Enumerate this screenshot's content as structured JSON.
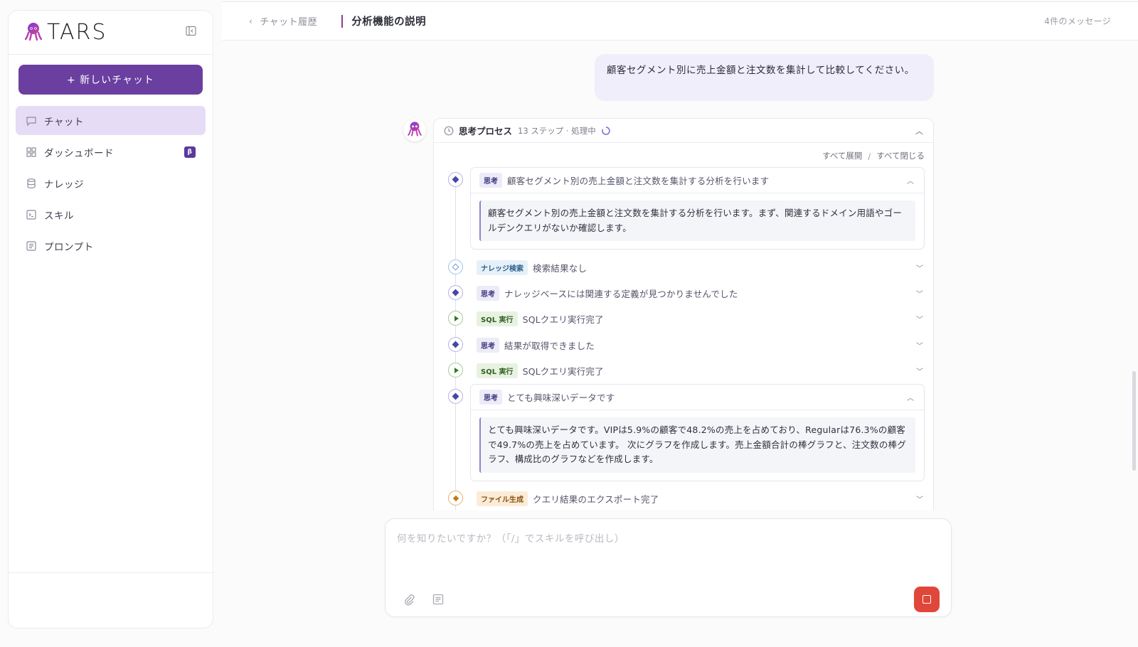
{
  "sidebar": {
    "logo_text": "TARS",
    "new_chat_label": "+ 新しいチャット",
    "items": [
      {
        "label": "チャット",
        "icon": "chat-icon",
        "active": true
      },
      {
        "label": "ダッシュボード",
        "icon": "dashboard-icon",
        "badge": "β"
      },
      {
        "label": "ナレッジ",
        "icon": "database-icon"
      },
      {
        "label": "スキル",
        "icon": "terminal-icon"
      },
      {
        "label": "プロンプト",
        "icon": "prompt-icon"
      }
    ]
  },
  "header": {
    "back_label": "チャット履歴",
    "title": "分析機能の説明",
    "message_count": "4件のメッセージ"
  },
  "user_message": "顧客セグメント別に売上金額と注文数を集計して比較してください。",
  "process": {
    "title": "思考プロセス",
    "meta": "13 ステップ · 処理中",
    "expand_all": "すべて展開",
    "separator": "/",
    "collapse_all": "すべて閉じる",
    "steps": [
      {
        "type": "think",
        "tag": "思考",
        "label": "顧客セグメント別の売上金額と注文数を集計する分析を行います",
        "expanded": true,
        "body": "顧客セグメント別の売上金額と注文数を集計する分析を行います。まず、関連するドメイン用語やゴールデンクエリがないか確認します。"
      },
      {
        "type": "knowledge",
        "tag": "ナレッジ検索",
        "label": "検索結果なし"
      },
      {
        "type": "think",
        "tag": "思考",
        "label": "ナレッジベースには関連する定義が見つかりませんでした"
      },
      {
        "type": "sql",
        "tag": "SQL 実行",
        "label": "SQLクエリ実行完了"
      },
      {
        "type": "think",
        "tag": "思考",
        "label": "結果が取得できました"
      },
      {
        "type": "sql",
        "tag": "SQL 実行",
        "label": "SQLクエリ実行完了"
      },
      {
        "type": "think",
        "tag": "思考",
        "label": "とても興味深いデータです",
        "expanded": true,
        "body": "とても興味深いデータです。VIPは5.9%の顧客で48.2%の売上を占めており、Regularは76.3%の顧客で49.7%の売上を占めています。 次にグラフを作成します。売上金額合計の棒グラフと、注文数の棒グラフ、構成比のグラフなどを作成します。"
      },
      {
        "type": "file",
        "tag": "ファイル生成",
        "label": "クエリ結果のエクスポート完了"
      }
    ]
  },
  "composer": {
    "placeholder": "何を知りたいですか？（「/」でスキルを呼び出し）"
  },
  "colors": {
    "accent": "#6b3fa0",
    "active_nav": "#e6dcf6",
    "user_bubble": "#f1eefb",
    "stop_button": "#e0463a"
  }
}
